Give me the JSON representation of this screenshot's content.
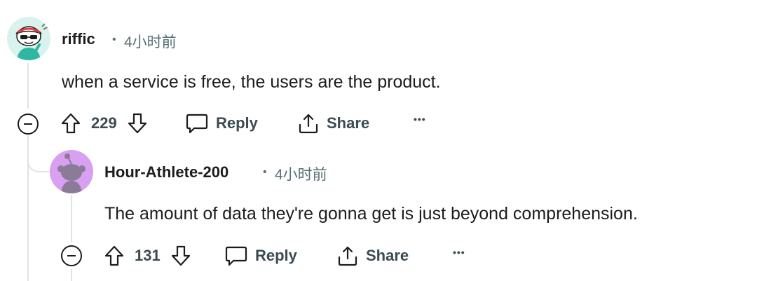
{
  "comments": [
    {
      "username": "riffic",
      "separator": "•",
      "timestamp": "4小时前",
      "body": "when a service is free, the users are the product.",
      "votes": "229",
      "reply_label": "Reply",
      "share_label": "Share",
      "more_label": "•••"
    },
    {
      "username": "Hour-Athlete-200",
      "separator": "•",
      "timestamp": "4小时前",
      "body": "The amount of data they're gonna get is just beyond comprehension.",
      "votes": "131",
      "reply_label": "Reply",
      "share_label": "Share",
      "more_label": "•••"
    }
  ],
  "colors": {
    "avatar1_bg": "#d9f2ee",
    "avatar2_bg": "#d8a0f0",
    "avatar2_snoo": "#8c7a99",
    "thread_line": "#e1e3e6",
    "meta_text": "#576f76"
  },
  "icons": {
    "collapse": "minus-circle-icon",
    "upvote": "arrow-up-outline-icon",
    "downvote": "arrow-down-outline-icon",
    "reply": "speech-bubble-icon",
    "share": "share-arrow-icon",
    "more": "ellipsis-icon"
  }
}
